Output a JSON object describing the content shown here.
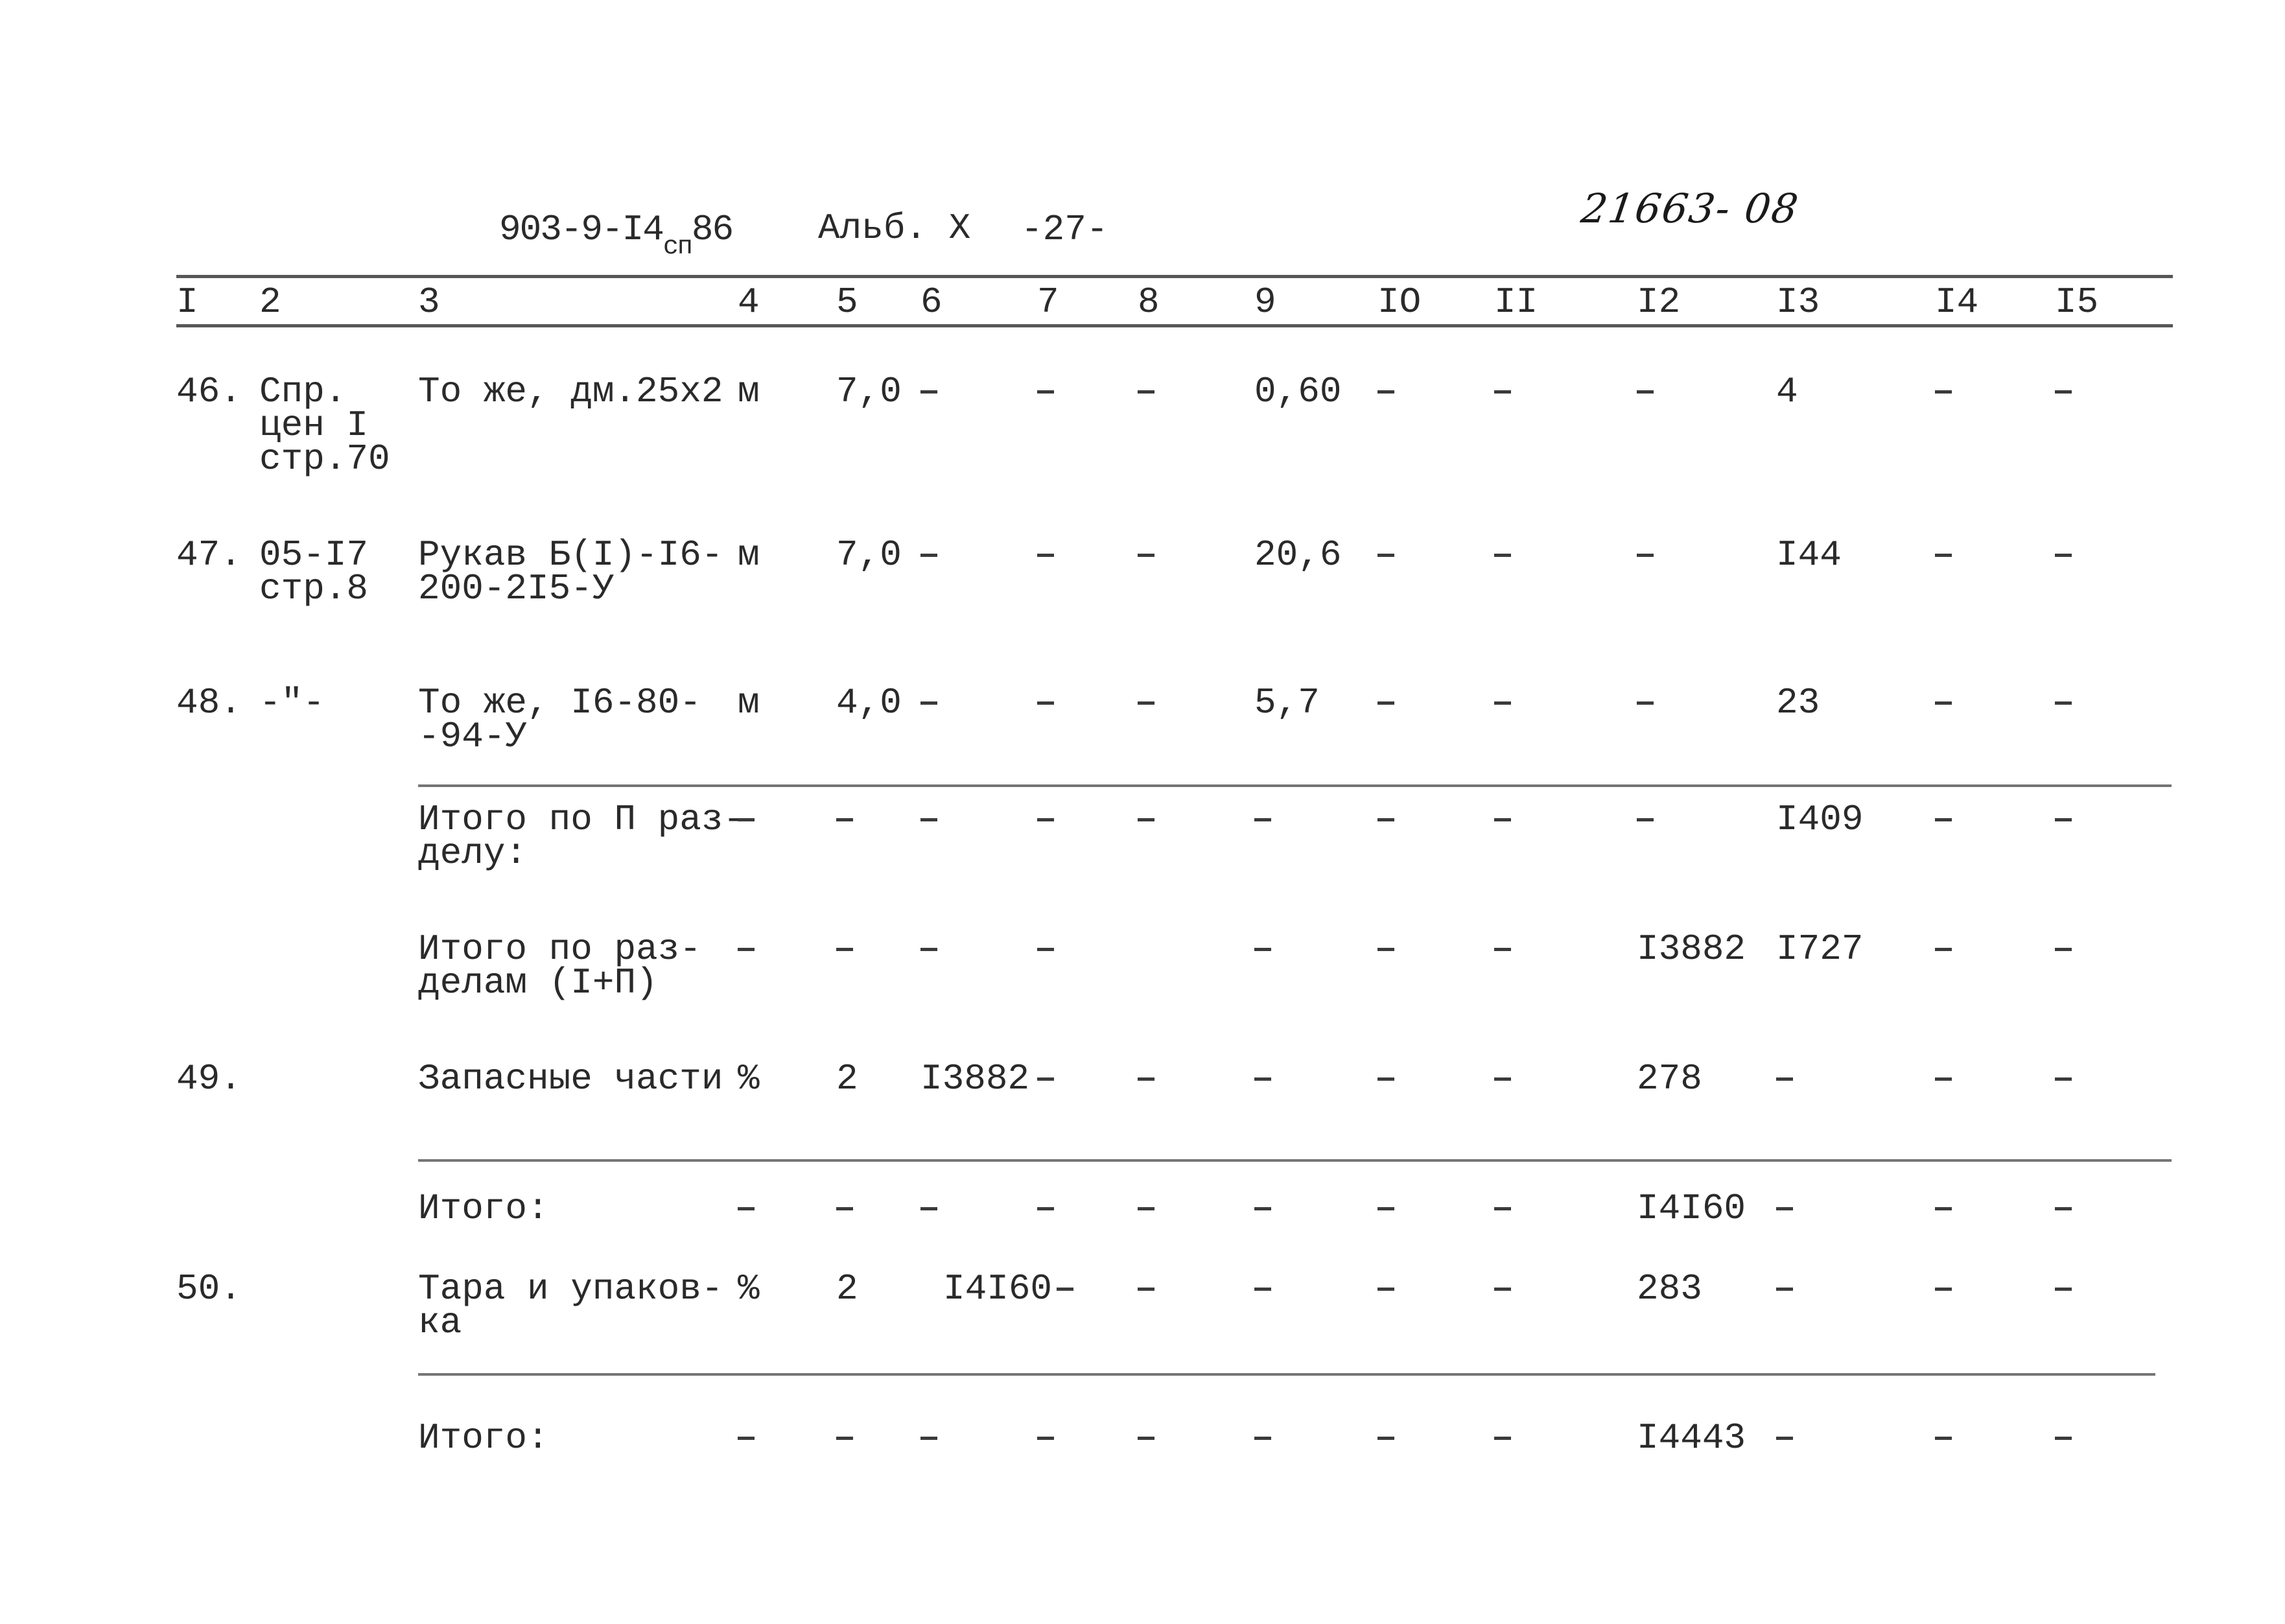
{
  "header": {
    "doc_code": "903-9-I4",
    "doc_code_sub": "сп",
    "doc_code_year": "86",
    "album": "Альб. X",
    "page_number": "-27-",
    "handwritten_number": "21663- 08"
  },
  "table": {
    "columns": [
      "I",
      "2",
      "3",
      "4",
      "5",
      "6",
      "7",
      "8",
      "9",
      "IO",
      "II",
      "I2",
      "I3",
      "I4",
      "I5"
    ],
    "rows": [
      {
        "num": "46.",
        "ref": "Спр.\nцен I\nстр.70",
        "name": "То же, дм.25х2",
        "unit": "м",
        "c5": "7,0",
        "c6": "-",
        "c7": "-",
        "c8": "-",
        "c9": "0,60",
        "c10": "-",
        "c11": "-",
        "c12": "-",
        "c13": "4",
        "c14": "-",
        "c15": "-"
      },
      {
        "num": "47.",
        "ref": "05-I7\nстр.8",
        "name": "Рукав Б(I)-I6-\n200-2I5-У",
        "unit": "м",
        "c5": "7,0",
        "c6": "-",
        "c7": "-",
        "c8": "-",
        "c9": "20,6",
        "c10": "-",
        "c11": "-",
        "c12": "-",
        "c13": "I44",
        "c14": "-",
        "c15": "-"
      },
      {
        "num": "48.",
        "ref": "-\"-",
        "name": "То же, I6-80-\n-94-У",
        "unit": "м",
        "c5": "4,0",
        "c6": "-",
        "c7": "-",
        "c8": "-",
        "c9": "5,7",
        "c10": "-",
        "c11": "-",
        "c12": "-",
        "c13": "23",
        "c14": "-",
        "c15": "-"
      },
      {
        "num": "",
        "ref": "",
        "name": "Итого по П раз-\nделу:",
        "unit": "-",
        "c5": "-",
        "c6": "-",
        "c7": "-",
        "c8": "-",
        "c9": "-",
        "c10": "-",
        "c11": "-",
        "c12": "-",
        "c13": "I409",
        "c14": "-",
        "c15": "-"
      },
      {
        "num": "",
        "ref": "",
        "name": "Итого по раз-\nделам (I+П)",
        "unit": "-",
        "c5": "-",
        "c6": "-",
        "c7": "-",
        "c8": "",
        "c9": "-",
        "c10": "-",
        "c11": "-",
        "c12": "I3882",
        "c13": "I727",
        "c14": "-",
        "c15": "-"
      },
      {
        "num": "49.",
        "ref": "",
        "name": "Запасные части",
        "unit": "%",
        "c5": "2",
        "c6": "I3882",
        "c7": "-",
        "c8": "-",
        "c9": "-",
        "c10": "-",
        "c11": "-",
        "c12": "278",
        "c13": "-",
        "c14": "-",
        "c15": "-"
      },
      {
        "num": "",
        "ref": "",
        "name": "Итого:",
        "unit": "-",
        "c5": "-",
        "c6": "-",
        "c7": "-",
        "c8": "-",
        "c9": "-",
        "c10": "-",
        "c11": "-",
        "c12": "I4I60",
        "c13": "-",
        "c14": "-",
        "c15": "-"
      },
      {
        "num": "50.",
        "ref": "",
        "name": "Тара и упаков-\nка",
        "unit": "%",
        "c5": "2",
        "c6": "I4I60",
        "c7": "-",
        "c8": "-",
        "c9": "-",
        "c10": "-",
        "c11": "-",
        "c12": "283",
        "c13": "-",
        "c14": "-",
        "c15": "-"
      },
      {
        "num": "",
        "ref": "",
        "name": "Итого:",
        "unit": "-",
        "c5": "-",
        "c6": "-",
        "c7": "-",
        "c8": "-",
        "c9": "-",
        "c10": "-",
        "c11": "-",
        "c12": "I4443",
        "c13": "-",
        "c14": "-",
        "c15": "-"
      }
    ]
  }
}
